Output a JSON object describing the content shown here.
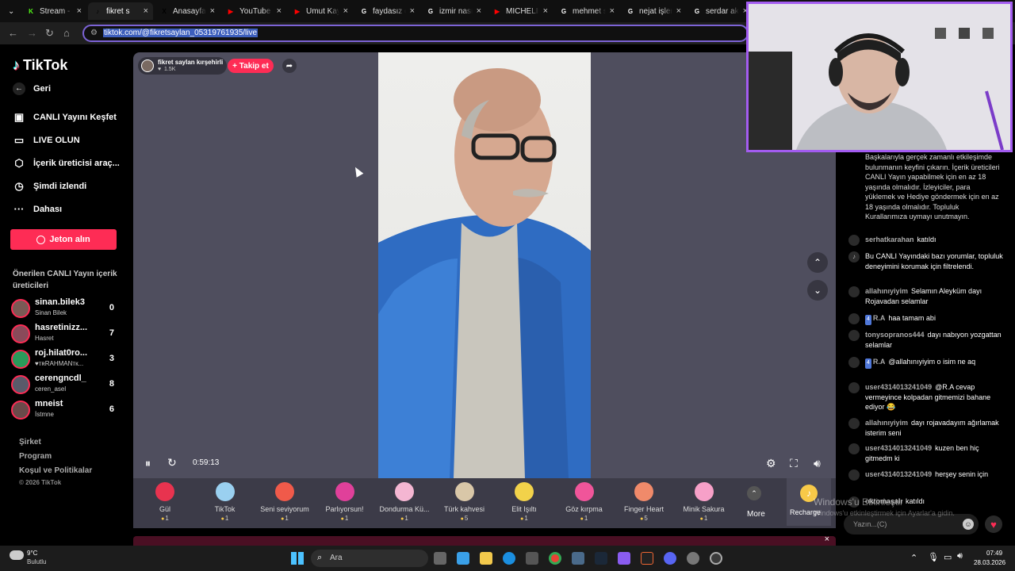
{
  "browser": {
    "tabs": [
      {
        "label": "Stream - K",
        "favicon": "K",
        "fav_color": "#53fc18"
      },
      {
        "label": "fikret s",
        "favicon": "♪",
        "fav_color": "#000000",
        "active": true
      },
      {
        "label": "Anasayfa /",
        "favicon": "X",
        "fav_color": "#000000"
      },
      {
        "label": "YouTube",
        "favicon": "▶",
        "fav_color": "#ff0000"
      },
      {
        "label": "Umut Kay",
        "favicon": "▶",
        "fav_color": "#ff0000"
      },
      {
        "label": "faydasız ol",
        "favicon": "G",
        "fav_color": "#ffffff"
      },
      {
        "label": "izmir nasrı",
        "favicon": "G",
        "fav_color": "#ffffff"
      },
      {
        "label": "MICHELIN",
        "favicon": "▶",
        "fav_color": "#ff0000"
      },
      {
        "label": "mehmet s",
        "favicon": "G",
        "fav_color": "#ffffff"
      },
      {
        "label": "nejat işler",
        "favicon": "G",
        "fav_color": "#ffffff"
      },
      {
        "label": "serdar ak",
        "favicon": "G",
        "fav_color": "#ffffff"
      }
    ],
    "url": "tiktok.com/@fikretsaylan_05319761935/live"
  },
  "sidebar": {
    "logo": "TikTok",
    "back": "Geri",
    "items": [
      {
        "icon": "live-explore-icon",
        "glyph": "▣",
        "label": "CANLI Yayını Keşfet"
      },
      {
        "icon": "go-live-icon",
        "glyph": "▭",
        "label": "LIVE OLUN"
      },
      {
        "icon": "creator-tools-icon",
        "glyph": "⬡",
        "label": "İçerik üreticisi araç..."
      },
      {
        "icon": "watching-icon",
        "glyph": "◷",
        "label": "Şimdi izlendi"
      },
      {
        "icon": "more-icon",
        "glyph": "···",
        "label": "Dahası"
      }
    ],
    "coin_button": "Jeton alın",
    "suggested_title": "Önerilen CANLI Yayın içerik üreticileri",
    "creators": [
      {
        "name": "sinan.bilek3",
        "sub": "Sinan Bilek",
        "count": "0"
      },
      {
        "name": "hasretinizz...",
        "sub": "Hasret",
        "count": "7"
      },
      {
        "name": "roj.hilat0ro...",
        "sub": "♥тʀRAHMANтк...",
        "count": "3"
      },
      {
        "name": "cerengncdl_",
        "sub": "ceren_asel",
        "count": "8"
      },
      {
        "name": "mneist",
        "sub": "İstmne",
        "count": "6"
      }
    ],
    "footer": [
      "Şirket",
      "Program",
      "Koşul ve Politikalar"
    ],
    "copyright": "© 2026 TikTok"
  },
  "player": {
    "host_name": "fikret saylan kırşehirli",
    "host_likes": "1.5K",
    "follow": "+ Takip et",
    "time": "0:59:13"
  },
  "gifts": [
    {
      "name": "Gül",
      "price": "1",
      "color": "#e8334f"
    },
    {
      "name": "TikTok",
      "price": "1",
      "color": "#9ad0f0"
    },
    {
      "name": "Seni seviyorum",
      "price": "1",
      "color": "#f05a4a"
    },
    {
      "name": "Parlıyorsun!",
      "price": "1",
      "color": "#e0409a"
    },
    {
      "name": "Dondurma Kü...",
      "price": "1",
      "color": "#f4b6d2"
    },
    {
      "name": "Türk kahvesi",
      "price": "5",
      "color": "#d9c7a8"
    },
    {
      "name": "Elit Işıltı",
      "price": "1",
      "color": "#f2d24a"
    },
    {
      "name": "Göz kırpma",
      "price": "1",
      "color": "#f0559a"
    },
    {
      "name": "Finger Heart",
      "price": "5",
      "color": "#f08a6a"
    },
    {
      "name": "Minik Sakura",
      "price": "1",
      "color": "#f7a0c8"
    }
  ],
  "gift_more": "More",
  "recharge": "Recharge",
  "chat": {
    "notice": "Başkalarıyla gerçek zamanlı etkileşimde bulunmanın keyfini çıkarın. İçerik üreticileri CANLI Yayın yapabilmek için en az 18 yaşında olmalıdır. İzleyiciler, para yüklemek ve Hediye göndermek için en az 18 yaşında olmalıdır. Topluluk Kurallarımıza uymayı unutmayın.",
    "messages": [
      {
        "user": "serhatkarahan",
        "text": "katıldı"
      },
      {
        "user": "",
        "text": "Bu CANLI Yayındaki bazı yorumlar, topluluk deneyimini korumak için filtrelendi."
      },
      {
        "user": "allahınıyiyim",
        "text": "Selamın Aleyküm dayı Rojavadan selamlar"
      },
      {
        "user": "R.A",
        "text": "haa tamam abi",
        "level": "4"
      },
      {
        "user": "tonysopranos444",
        "text": "dayı nabıyon yozgattan selamlar"
      },
      {
        "user": "R.A",
        "text": "@allahınıyiyim o isim ne aq",
        "level": "4"
      },
      {
        "user": "user4314013241049",
        "text": "@R.A cevap vermeyince kolpadan gitmemizi bahane ediyor 😂"
      },
      {
        "user": "allahınıyiyim",
        "text": "dayı rojavadayım ağırlamak isterim seni"
      },
      {
        "user": "user4314013241049",
        "text": "kuzen ben hiç gitmedm ki"
      },
      {
        "user": "user4314013241049",
        "text": "herşey senin için"
      },
      {
        "user": "oktomaşalı",
        "text": "katıldı"
      }
    ],
    "input_placeholder": "Yazın...(C)"
  },
  "watermark": {
    "line1": "Windows'u Etkinleştir",
    "line2": "Windows'u etkinleştirmek için Ayarlar'a gidin."
  },
  "taskbar": {
    "weather_temp": "9°C",
    "weather_desc": "Bulutlu",
    "search": "Ara",
    "time": "07:49",
    "date": "28.03.2026"
  }
}
